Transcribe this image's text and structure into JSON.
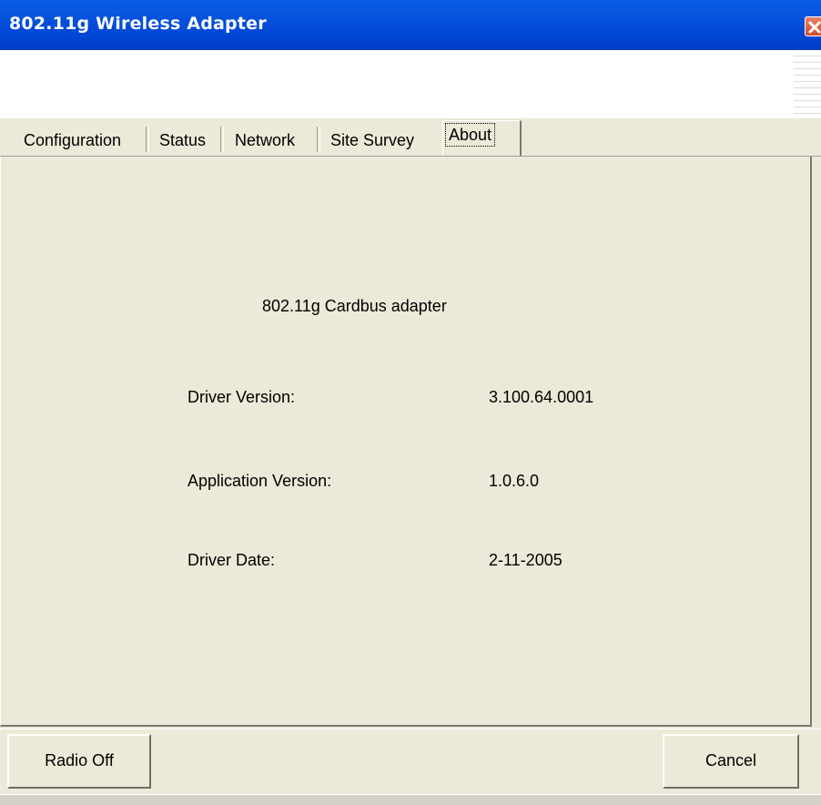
{
  "window": {
    "title": "802.11g Wireless Adapter"
  },
  "tabs": [
    {
      "label": "Configuration",
      "active": false
    },
    {
      "label": "Status",
      "active": false
    },
    {
      "label": "Network",
      "active": false
    },
    {
      "label": "Site Survey",
      "active": false
    },
    {
      "label": "About",
      "active": true
    }
  ],
  "about": {
    "product_name": "802.11g Cardbus adapter",
    "rows": [
      {
        "label": "Driver Version:",
        "value": "3.100.64.0001"
      },
      {
        "label": "Application Version:",
        "value": "1.0.6.0"
      },
      {
        "label": "Driver Date:",
        "value": "2-11-2005"
      }
    ]
  },
  "buttons": {
    "radio_off": "Radio Off",
    "cancel": "Cancel"
  },
  "icons": {
    "close": "close-icon"
  },
  "colors": {
    "titlebar": "#0046d5",
    "face": "#ece9d8",
    "close": "#d34b2c"
  }
}
